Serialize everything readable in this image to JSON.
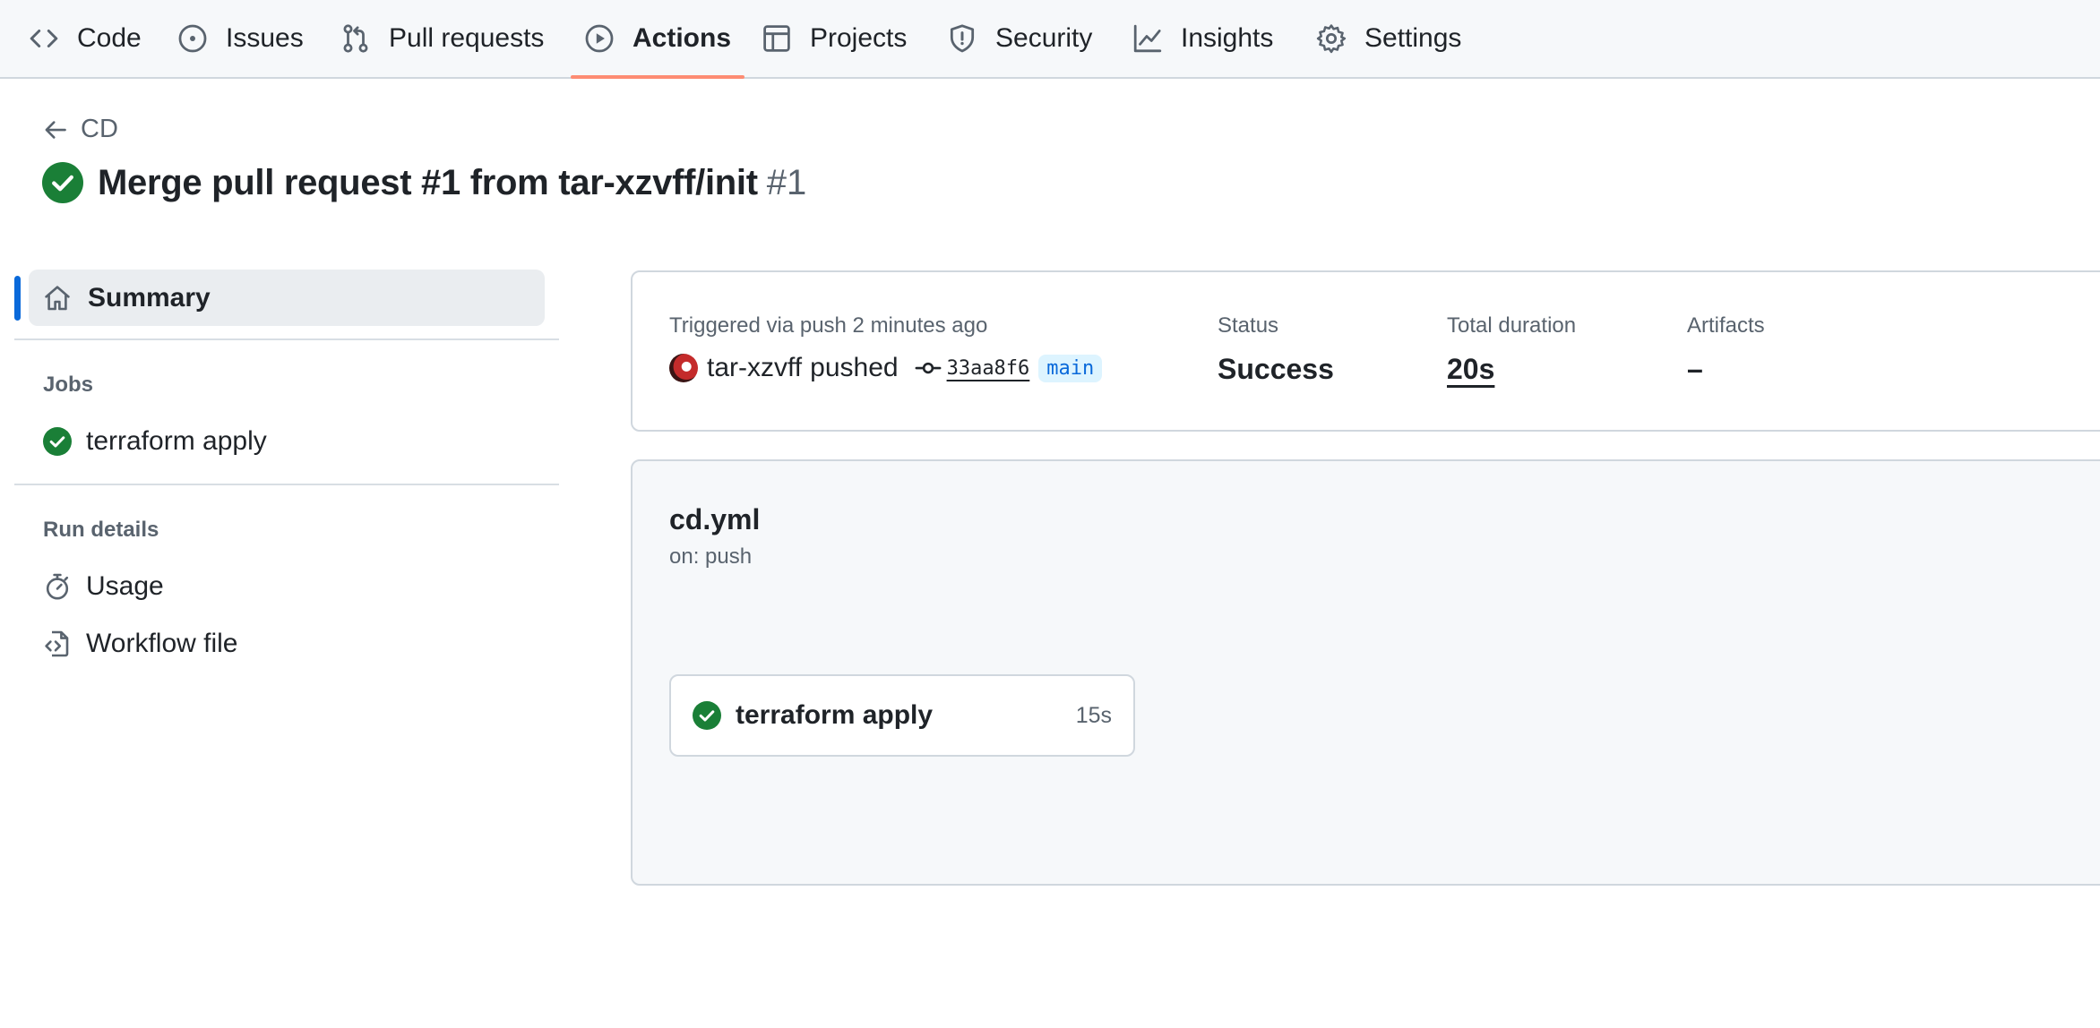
{
  "nav": {
    "items": [
      {
        "label": "Code",
        "icon": "code-icon"
      },
      {
        "label": "Issues",
        "icon": "issue-icon"
      },
      {
        "label": "Pull requests",
        "icon": "pull-request-icon"
      },
      {
        "label": "Actions",
        "icon": "play-icon",
        "active": true
      },
      {
        "label": "Projects",
        "icon": "table-icon"
      },
      {
        "label": "Security",
        "icon": "shield-icon"
      },
      {
        "label": "Insights",
        "icon": "graph-icon"
      },
      {
        "label": "Settings",
        "icon": "gear-icon"
      }
    ],
    "active_underline_color": "#fd8c73"
  },
  "header": {
    "back_label": "CD",
    "title": "Merge pull request #1 from tar-xzvff/init",
    "run_number": "#1",
    "status_icon": "check-circle-fill-icon",
    "success_color": "#1a7f37"
  },
  "sidebar": {
    "summary_label": "Summary",
    "jobs_heading": "Jobs",
    "jobs": [
      {
        "label": "terraform apply",
        "icon": "check-circle-fill-icon"
      }
    ],
    "run_details_heading": "Run details",
    "run_details": [
      {
        "label": "Usage",
        "icon": "stopwatch-icon"
      },
      {
        "label": "Workflow file",
        "icon": "file-code-icon"
      }
    ]
  },
  "summary": {
    "triggered_label": "Triggered via push 2 minutes ago",
    "actor": "tar-xzvff",
    "action": "pushed",
    "commit_sha": "33aa8f6",
    "branch": "main",
    "status_label": "Status",
    "status_value": "Success",
    "duration_label": "Total duration",
    "duration_value": "20s",
    "artifacts_label": "Artifacts",
    "artifacts_value": "–"
  },
  "workflow": {
    "file": "cd.yml",
    "trigger": "on: push",
    "jobs": [
      {
        "name": "terraform apply",
        "duration": "15s",
        "status": "success"
      }
    ]
  }
}
